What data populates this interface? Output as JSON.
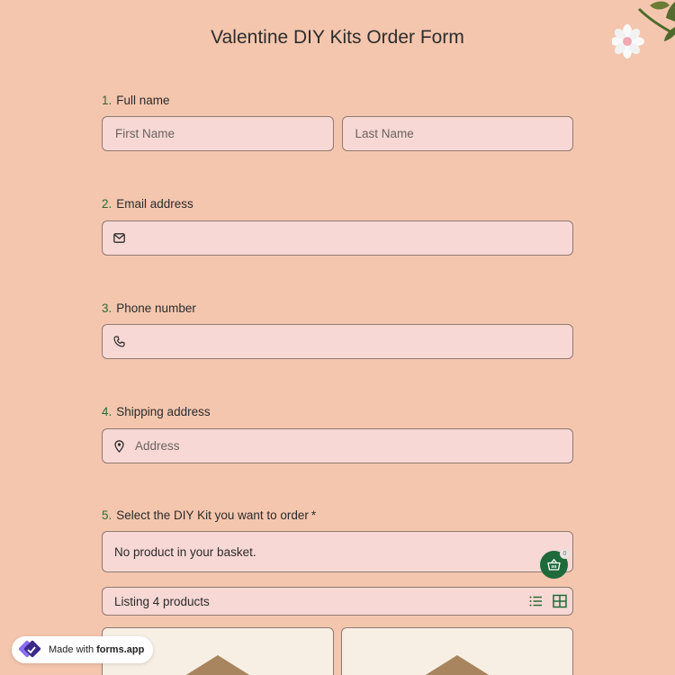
{
  "form": {
    "title": "Valentine DIY Kits Order Form"
  },
  "questions": [
    {
      "number": "1.",
      "label": "Full name",
      "first_placeholder": "First Name",
      "last_placeholder": "Last Name"
    },
    {
      "number": "2.",
      "label": "Email address",
      "icon": "envelope-icon",
      "placeholder": ""
    },
    {
      "number": "3.",
      "label": "Phone number",
      "icon": "phone-icon",
      "placeholder": ""
    },
    {
      "number": "4.",
      "label": "Shipping address",
      "icon": "map-pin-icon",
      "placeholder": "Address"
    },
    {
      "number": "5.",
      "label": "Select the DIY Kit you want to order",
      "required_mark": "*"
    }
  ],
  "basket": {
    "empty_text": "No product in your basket.",
    "count": "0",
    "icon": "basket-icon"
  },
  "listing": {
    "text": "Listing 4 products",
    "views": [
      "list-view-icon",
      "grid-view-icon"
    ]
  },
  "badge": {
    "prefix": "Made with",
    "brand": "forms.app"
  },
  "colors": {
    "background": "#f4c6ae",
    "field": "#f7d8d4",
    "accent_green": "#1f6a3a",
    "number_green": "#2f6b33"
  }
}
